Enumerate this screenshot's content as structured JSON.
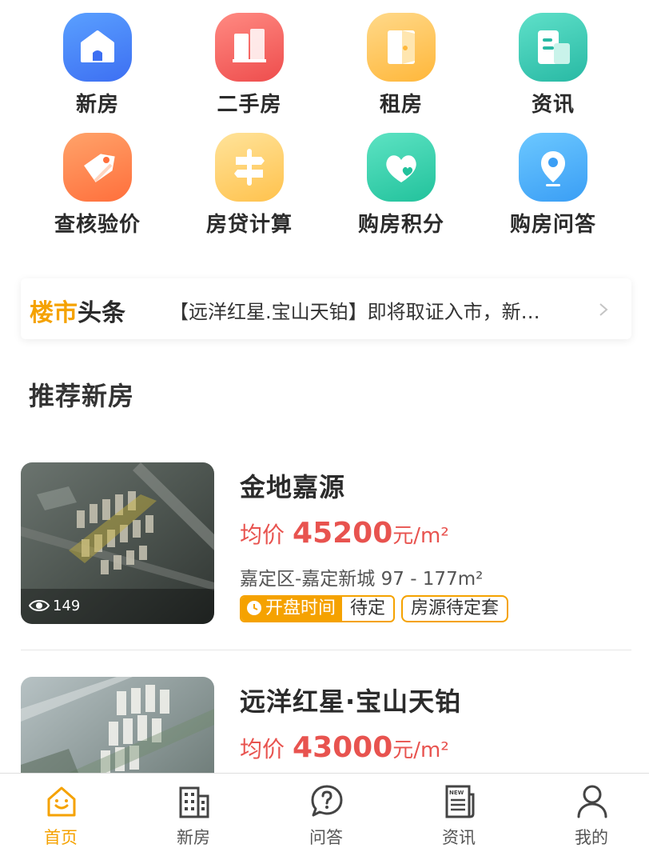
{
  "grid": [
    {
      "label": "新房",
      "icon": "house-icon"
    },
    {
      "label": "二手房",
      "icon": "building-icon"
    },
    {
      "label": "租房",
      "icon": "door-icon"
    },
    {
      "label": "资讯",
      "icon": "news-icon"
    },
    {
      "label": "查核验价",
      "icon": "price-tag-icon"
    },
    {
      "label": "房贷计算",
      "icon": "signpost-icon"
    },
    {
      "label": "购房积分",
      "icon": "heart-icon"
    },
    {
      "label": "购房问答",
      "icon": "location-pin-icon"
    }
  ],
  "headline": {
    "title_a": "楼市",
    "title_b": "头条",
    "text": "【远洋红星.宝山天铂】即将取证入市，新…"
  },
  "section_title": "推荐新房",
  "listings": [
    {
      "name": "金地嘉源",
      "price_label": "均价",
      "price": "45200",
      "unit": "元/m²",
      "location": "嘉定区-嘉定新城  97 - 177m²",
      "views": "149",
      "tag_open_label": "开盘时间",
      "tag_open_value": "待定",
      "tag_supply": "房源待定套"
    },
    {
      "name": "远洋红星·宝山天铂",
      "price_label": "均价",
      "price": "43000",
      "unit": "元/m²"
    }
  ],
  "tabbar": [
    {
      "label": "首页",
      "icon": "home-icon",
      "active": true
    },
    {
      "label": "新房",
      "icon": "building-icon",
      "active": false
    },
    {
      "label": "问答",
      "icon": "question-icon",
      "active": false
    },
    {
      "label": "资讯",
      "icon": "newspaper-icon",
      "active": false
    },
    {
      "label": "我的",
      "icon": "user-icon",
      "active": false
    }
  ],
  "colors": {
    "accent": "#f5a200",
    "price": "#e8534f"
  }
}
